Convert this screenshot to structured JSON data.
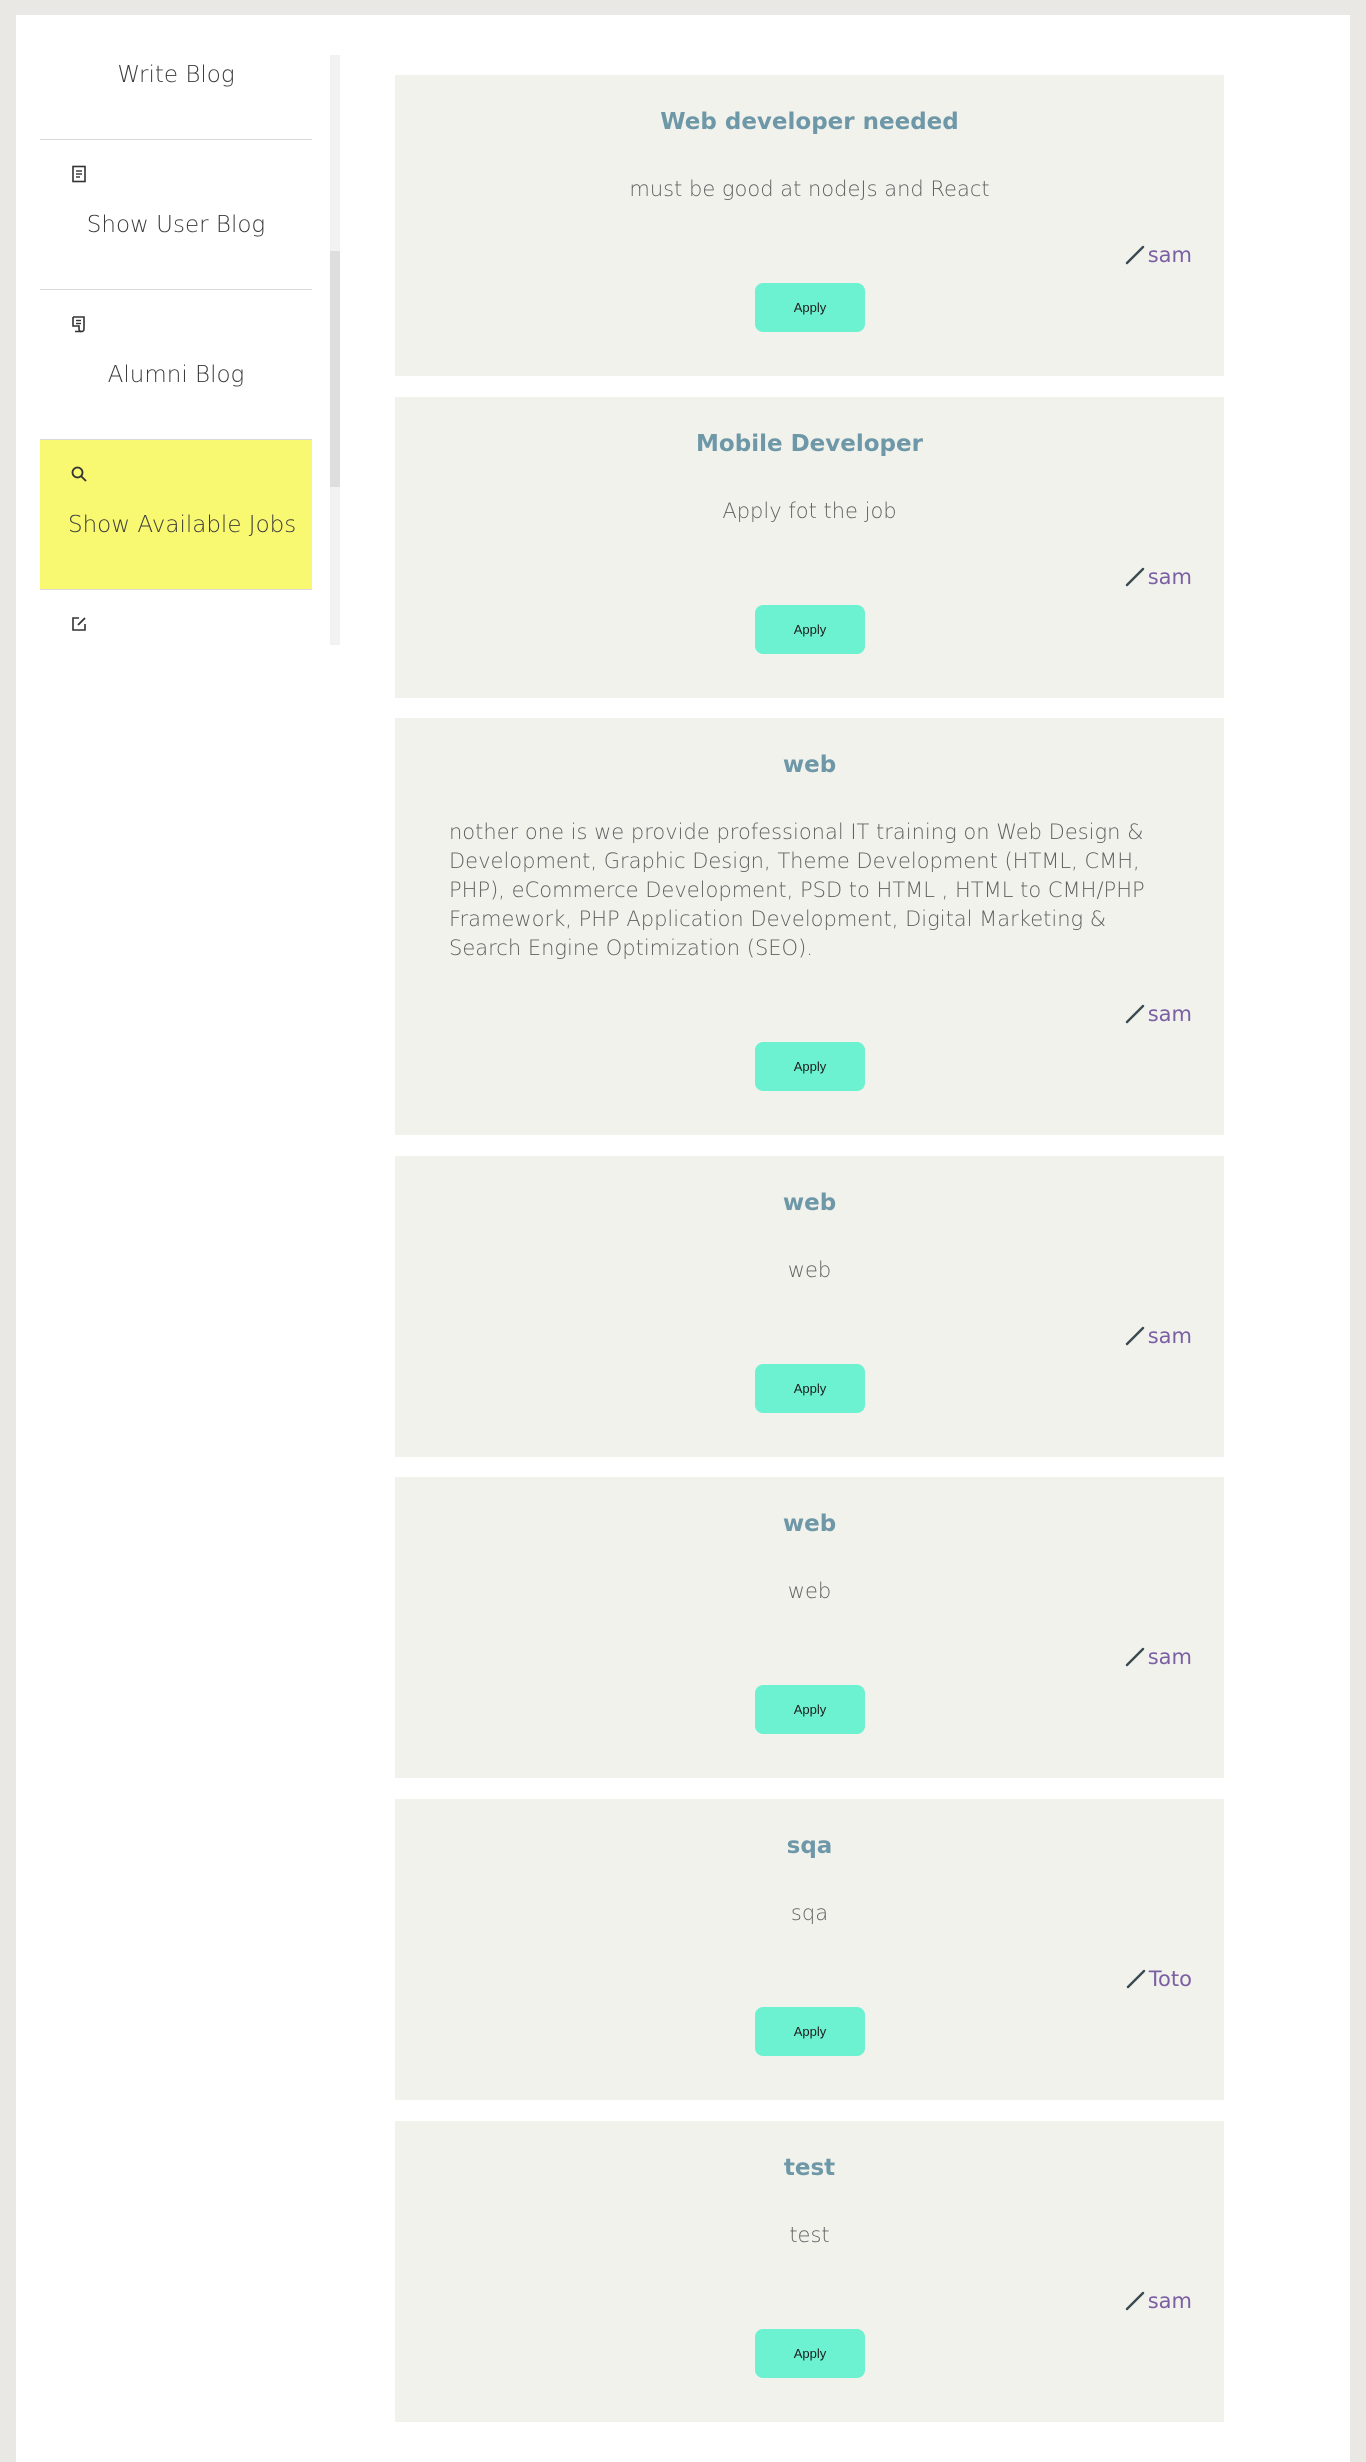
{
  "sidebar": {
    "items": [
      {
        "label": "Write Blog",
        "icon": "pencil-icon"
      },
      {
        "label": "Show User Blog",
        "icon": "document-icon"
      },
      {
        "label": "Alumni Blog",
        "icon": "newspaper-icon"
      },
      {
        "label": "Show Available Jobs",
        "icon": "search-icon"
      },
      {
        "label": "",
        "icon": "edit-square-icon"
      }
    ],
    "active_color": "#f8f871"
  },
  "jobs": [
    {
      "title": "Web developer needed",
      "description": "must be good at nodeJs and React",
      "author": "sam",
      "apply_label": "Apply"
    },
    {
      "title": "Mobile Developer",
      "description": "Apply fot the job",
      "author": "sam",
      "apply_label": "Apply"
    },
    {
      "title": "web",
      "description": "nother one is we provide professional IT training on Web Design & Development, Graphic Design, Theme Development (HTML, CMH, PHP), eCommerce Development, PSD to HTML , HTML to CMH/PHP Framework, PHP Application Development, Digital Marketing & Search Engine Optimization (SEO).",
      "author": "sam",
      "apply_label": "Apply"
    },
    {
      "title": "web",
      "description": "web",
      "author": "sam",
      "apply_label": "Apply"
    },
    {
      "title": "web",
      "description": "web",
      "author": "sam",
      "apply_label": "Apply"
    },
    {
      "title": "sqa",
      "description": "sqa",
      "author": "Toto",
      "apply_label": "Apply"
    },
    {
      "title": "test",
      "description": "test",
      "author": "sam",
      "apply_label": "Apply"
    }
  ],
  "colors": {
    "card_background": "#f2f2ed",
    "title": "#6e98a8",
    "apply_button": "#6cf2d1",
    "author": "#7a5fa3"
  }
}
